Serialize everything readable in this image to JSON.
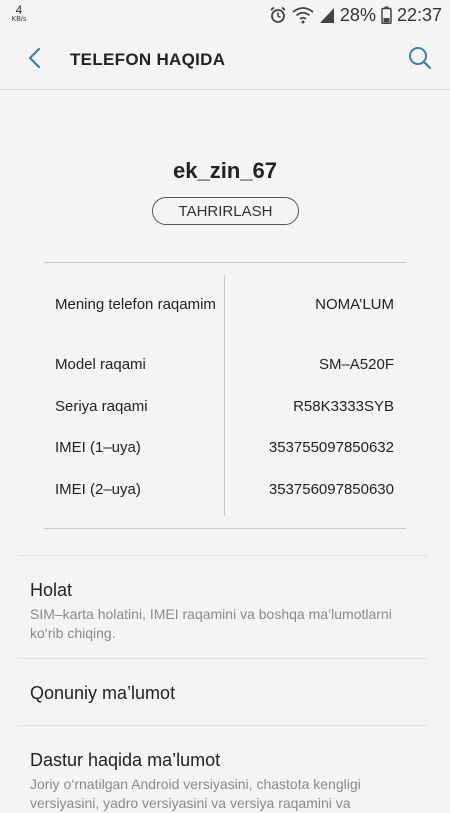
{
  "status_bar": {
    "speed_value": "4",
    "speed_unit": "KB/s",
    "battery_percent": "28%",
    "time": "22:37",
    "icons": [
      "alarm-icon",
      "wifi-icon",
      "signal-icon",
      "battery-icon"
    ]
  },
  "app_bar": {
    "title": "TELEFON HAQIDA",
    "back_icon": "back-arrow-icon",
    "search_icon": "search-icon",
    "accent_color": "#3d7fa6"
  },
  "device": {
    "name": "ek_zin_67",
    "edit_label": "TAHRIRLASH"
  },
  "info": [
    {
      "label": "Mening telefon raqamim",
      "value": "NOMA’LUM"
    },
    {
      "label": "Model raqami",
      "value": "SM–A520F"
    },
    {
      "label": "Seriya raqami",
      "value": "R58K3333SYB"
    },
    {
      "label": "IMEI (1–uya)",
      "value": "353755097850632"
    },
    {
      "label": "IMEI (2–uya)",
      "value": "353756097850630"
    }
  ],
  "menu": [
    {
      "title": "Holat",
      "desc": "SIM–karta holatini, IMEI raqamini va boshqa ma’lumotlarni ko‘rib chiqing."
    },
    {
      "title": "Qonuniy ma’lumot",
      "desc": ""
    },
    {
      "title": "Dastur haqida ma’lumot",
      "desc": "Joriy o‘rnatilgan Android versiyasini, chastota kengligi versiyasini, yadro versiyasini va versiya raqamini va"
    }
  ]
}
